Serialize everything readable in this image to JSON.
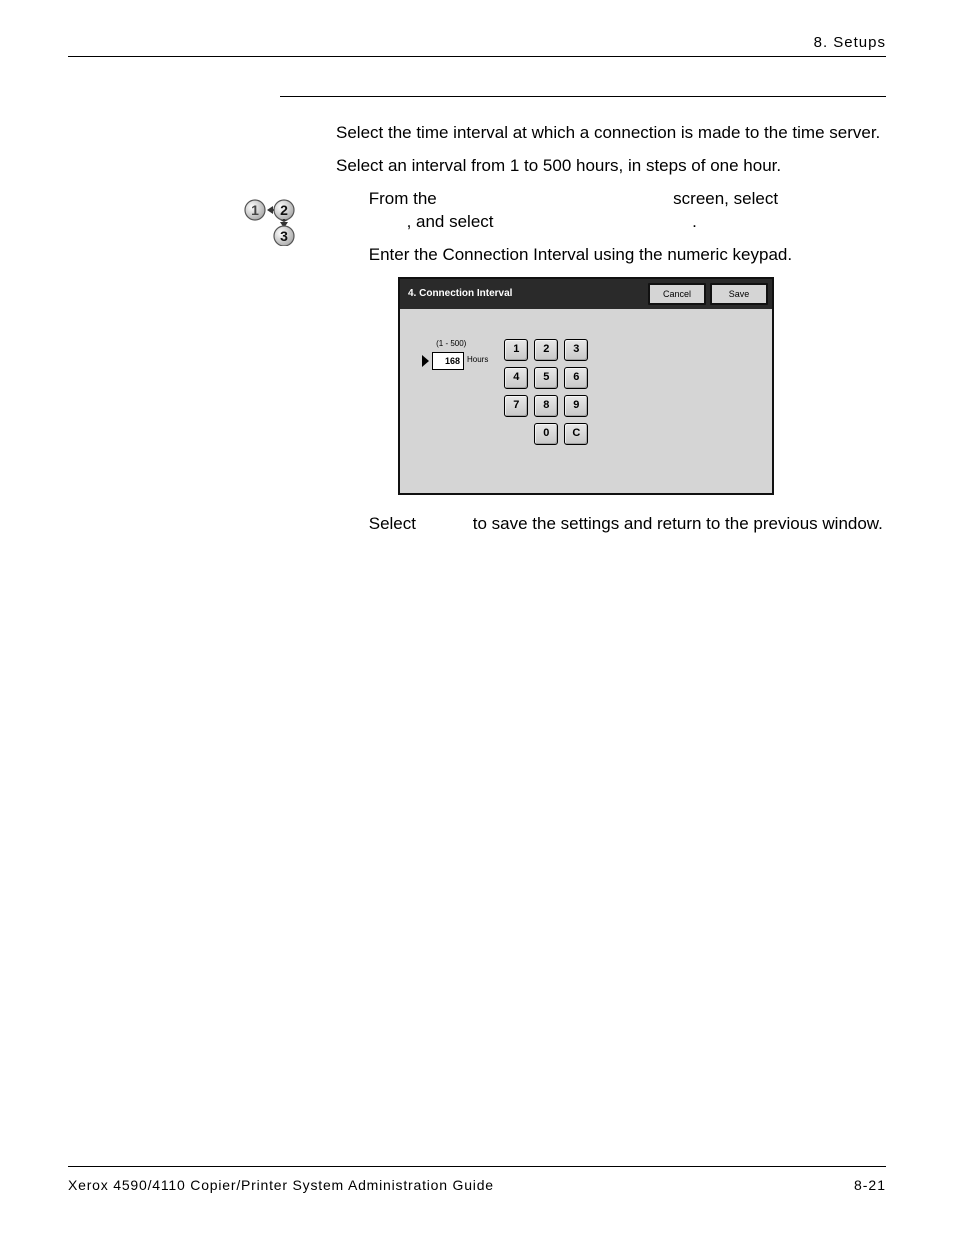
{
  "header": {
    "chapter": "8. Setups"
  },
  "body": {
    "p1": "Select the time interval at which a connection is made to the time server.",
    "p2": "Select an interval from 1 to 500 hours, in steps of one hour.",
    "step1_a": "From the",
    "step1_b": "screen, select",
    "step1_c": ", and select",
    "step1_d": ".",
    "step2": "Enter the Connection Interval using the numeric keypad.",
    "step3_a": "Select",
    "step3_b": "to save the settings and return to the previous window."
  },
  "screenshot": {
    "title": "4. Connection Interval",
    "cancel": "Cancel",
    "save": "Save",
    "range": "(1 - 500)",
    "value": "168",
    "unit": "Hours",
    "keys": [
      "1",
      "2",
      "3",
      "4",
      "5",
      "6",
      "7",
      "8",
      "9",
      "",
      "0",
      "C"
    ]
  },
  "footer": {
    "left": "Xerox 4590/4110 Copier/Printer System Administration Guide",
    "right": "8-21"
  }
}
